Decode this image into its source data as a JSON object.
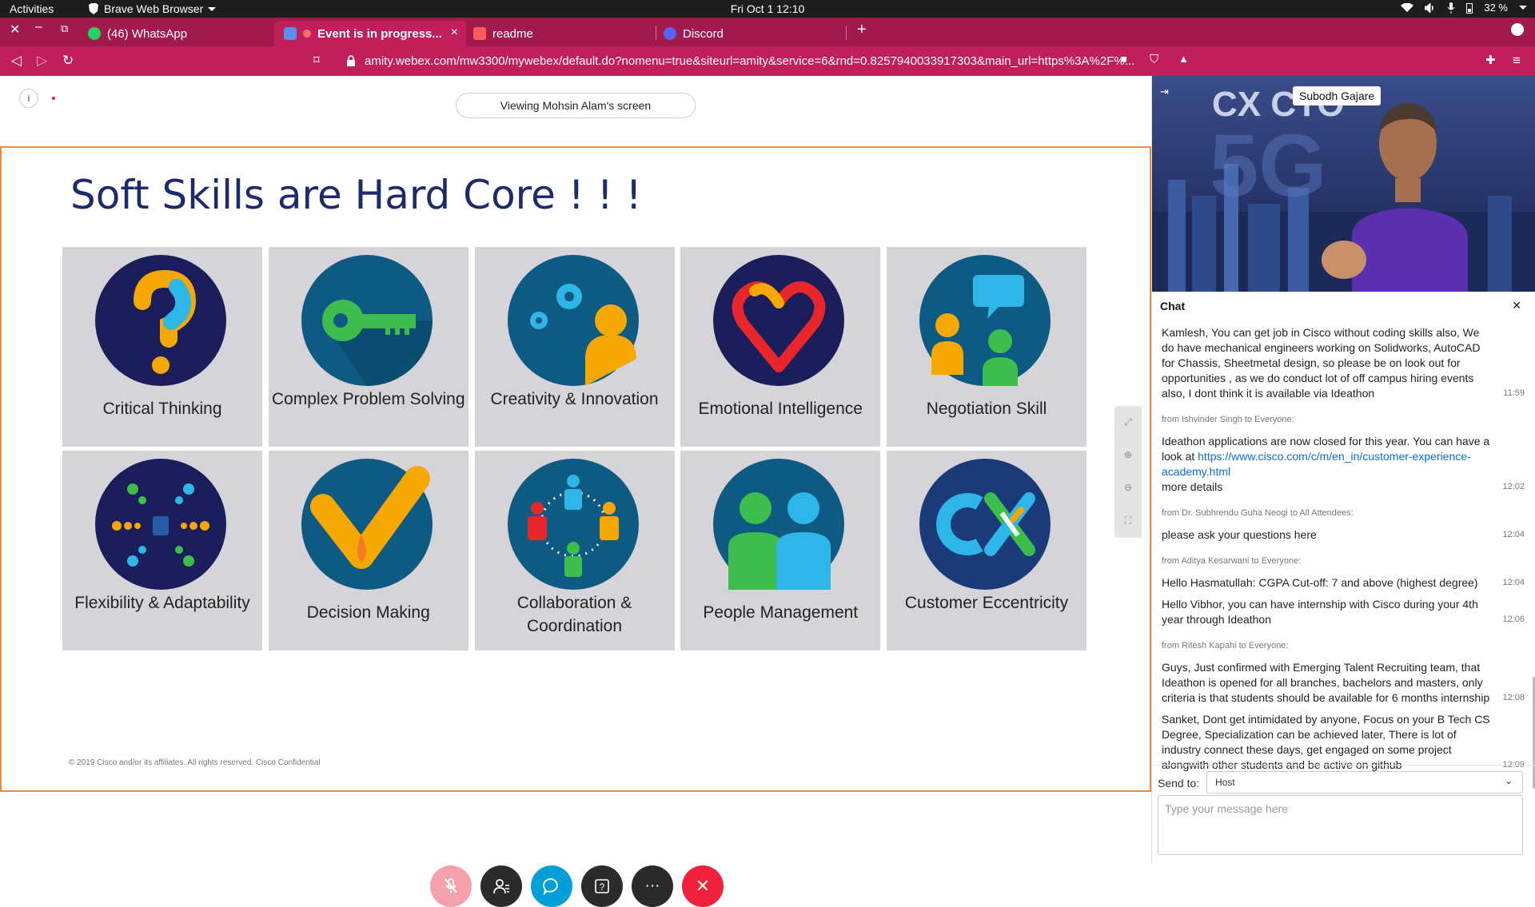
{
  "topbar": {
    "activities": "Activities",
    "app_name": "Brave Web Browser",
    "clock": "Fri Oct 1  12:10",
    "battery": "32 %"
  },
  "tabs": [
    {
      "label": "(46) WhatsApp",
      "icon": "whatsapp-icon",
      "color": "#25d366"
    },
    {
      "label": "Event is in progress...",
      "icon": "webex-icon",
      "color": "#ff6b6b",
      "active": true
    },
    {
      "label": "readme",
      "icon": "readme-icon",
      "color": "#ff5b5b"
    },
    {
      "label": "Discord",
      "icon": "discord-icon",
      "color": "#5865f2"
    }
  ],
  "navbar": {
    "url": "amity.webex.com/mw3300/mywebex/default.do?nomenu=true&siteurl=amity&service=6&rnd=0.8257940033917303&main_url=https%3A%2F%..."
  },
  "meeting": {
    "viewing": "Viewing Mohsin Alam's screen"
  },
  "slide": {
    "title": "Soft Skills are Hard Core ! ! !",
    "skills": [
      {
        "name": "Critical Thinking",
        "icon": "question-mark-icon"
      },
      {
        "name": "Complex Problem Solving",
        "icon": "key-icon"
      },
      {
        "name": "Creativity & Innovation",
        "icon": "gears-person-icon"
      },
      {
        "name": "Emotional Intelligence",
        "icon": "heart-icon"
      },
      {
        "name": "Negotiation Skill",
        "icon": "speech-people-icon"
      },
      {
        "name": "Flexibility & Adaptability",
        "icon": "burst-icon"
      },
      {
        "name": "Decision Making",
        "icon": "checkmark-icon"
      },
      {
        "name": "Collaboration & Coordination",
        "icon": "network-people-icon"
      },
      {
        "name": "People Management",
        "icon": "two-people-icon"
      },
      {
        "name": "Customer Eccentricity",
        "icon": "cx-logo-icon"
      }
    ],
    "footer": "© 2019  Cisco and/or its affiliates. All rights reserved.   Cisco Confidential"
  },
  "video": {
    "speaker": "Subodh Gajare",
    "backdrop_text": "CX CTO"
  },
  "chat": {
    "title": "Chat",
    "blocks": [
      {
        "from": "",
        "messages": [
          {
            "text": "Kamlesh, You can get job in Cisco without coding skills also, We do have mechanical engineers working on Solidworks, AutoCAD for Chassis, Sheetmetal design, so please be on look out for opportunities , as we do conduct lot of off campus hiring events also, I dont think it is available via Ideathon",
            "time": "11:59"
          }
        ]
      },
      {
        "from": "from Ishvinder Singh to Everyone:",
        "messages": [
          {
            "text": "Ideathon applications are now closed for this year. You can have a look at",
            "link": "https://www.cisco.com/c/m/en_in/customer-experience-academy.html",
            "after": "more details",
            "time": "12:02"
          }
        ]
      },
      {
        "from": "from Dr. Subhrendu Guha Neogi to All Attendees:",
        "messages": [
          {
            "text": "please ask your questions here",
            "time": "12:04"
          }
        ]
      },
      {
        "from": "from Aditya Kesarwani to Everyone:",
        "messages": [
          {
            "text": "Hello Hasmatullah: CGPA Cut-off: 7 and above (highest degree)",
            "time": "12:04"
          },
          {
            "text": "Hello Vibhor, you can have internship with Cisco during your 4th year through Ideathon",
            "time": "12:06"
          }
        ]
      },
      {
        "from": "from Ritesh Kapahi to Everyone:",
        "messages": [
          {
            "text": "Guys, Just confirmed with Emerging Talent Recruiting team, that Ideathon is opened for all branches, bachelors and masters, only criteria is that students should be available for 6 months internship",
            "time": "12:08"
          },
          {
            "text": "Sanket, Dont get intimidated by anyone, Focus on your B Tech CS Degree, Specialization can be achieved later, There is lot of industry connect these days, get engaged on some project alongwith other students and be active on github",
            "time": "12:09"
          }
        ]
      }
    ],
    "send_to_label": "Send to:",
    "send_to_value": "Host",
    "input_placeholder": "Type your message here"
  },
  "colors": {
    "tabbar": "#a2194c",
    "navbar": "#c01f5b",
    "slide_border": "#f08a3a",
    "title": "#1d2a6b",
    "card": "#d6d4d8",
    "end_call": "#f0213a",
    "chat_btn": "#049fd9"
  }
}
